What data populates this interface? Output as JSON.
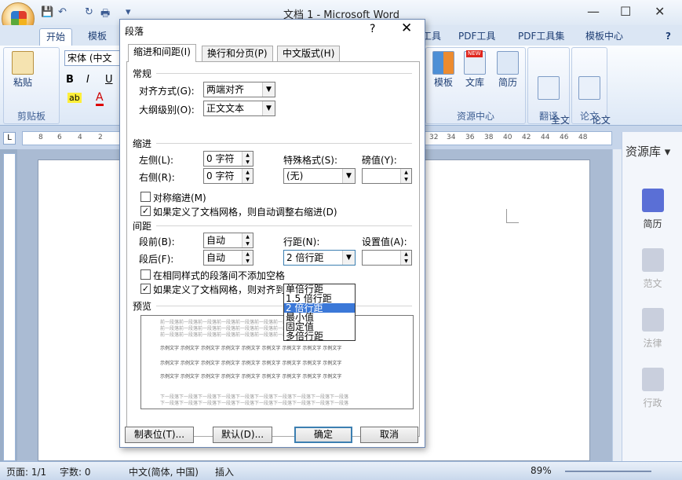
{
  "window": {
    "title": "文档 1 - Microsoft Word"
  },
  "qat": {
    "save": "💾",
    "undo": "↶",
    "redo": "↻",
    "print": "🖶",
    "more": "▾"
  },
  "controls": {
    "min": "—",
    "max": "☐",
    "close": "✕"
  },
  "ribbon_tabs": [
    "开始",
    "模板",
    "工具",
    "PDF工具",
    "PDF工具集",
    "模板中心"
  ],
  "help": "?",
  "ribbon": {
    "paste": "粘贴",
    "clipboard": "剪贴板",
    "font_name": "宋体 (中文正",
    "bold": "B",
    "italic": "I",
    "underline": "U",
    "highlight": "ab",
    "fontcolor": "A",
    "template": "模板",
    "library": "文库",
    "resume": "简历",
    "resource_center": "资源中心",
    "translate": "全文\n翻译",
    "translate_group": "翻译",
    "paper": "论文\n查重",
    "paper_group": "论文",
    "new_badge": "NEW"
  },
  "hruler": {
    "left": [
      "8",
      "6",
      "4",
      "2"
    ],
    "right": [
      "32",
      "34",
      "36",
      "38",
      "40",
      "42",
      "44",
      "46",
      "48"
    ]
  },
  "right_panel": {
    "title": "资源库",
    "items": [
      "简历",
      "范文",
      "法律",
      "行政"
    ]
  },
  "status": {
    "page": "页面: 1/1",
    "words": "字数: 0",
    "lang": "中文(简体, 中国)",
    "mode": "插入",
    "zoom": "89%"
  },
  "dialog": {
    "title": "段落",
    "help": "?",
    "close": "✕",
    "tabs": [
      "缩进和间距(I)",
      "换行和分页(P)",
      "中文版式(H)"
    ],
    "general": "常规",
    "alignment_label": "对齐方式(G):",
    "alignment_value": "两端对齐",
    "outline_label": "大纲级别(O):",
    "outline_value": "正文文本",
    "indent": "缩进",
    "left_label": "左侧(L):",
    "left_value": "0 字符",
    "right_label": "右侧(R):",
    "right_value": "0 字符",
    "special_label": "特殊格式(S):",
    "special_value": "(无)",
    "by_label": "磅值(Y):",
    "mirror": "对称缩进(M)",
    "auto_right": "如果定义了文档网格，则自动调整右缩进(D)",
    "spacing": "间距",
    "before_label": "段前(B):",
    "before_value": "自动",
    "after_label": "段后(F):",
    "after_value": "自动",
    "line_label": "行距(N):",
    "line_value": "2 倍行距",
    "at_label": "设置值(A):",
    "no_space": "在相同样式的段落间不添加空格",
    "snap_grid": "如果定义了文档网格，则对齐到",
    "line_options": [
      "单倍行距",
      "1.5 倍行距",
      "2 倍行距",
      "最小值",
      "固定值",
      "多倍行距"
    ],
    "selected_option": "2 倍行距",
    "preview": "预览",
    "preview_prev": "前一段落前一段落前一段落前一段落前一段落前一段落前一段落前一段落前一段落前一段落",
    "preview_sample": "示例文字 示例文字 示例文字 示例文字 示例文字 示例文字 示例文字 示例文字 示例文字",
    "preview_next": "下一段落下一段落下一段落下一段落下一段落下一段落下一段落下一段落下一段落下一段落",
    "btn_tabs": "制表位(T)...",
    "btn_default": "默认(D)...",
    "btn_ok": "确定",
    "btn_cancel": "取消"
  }
}
